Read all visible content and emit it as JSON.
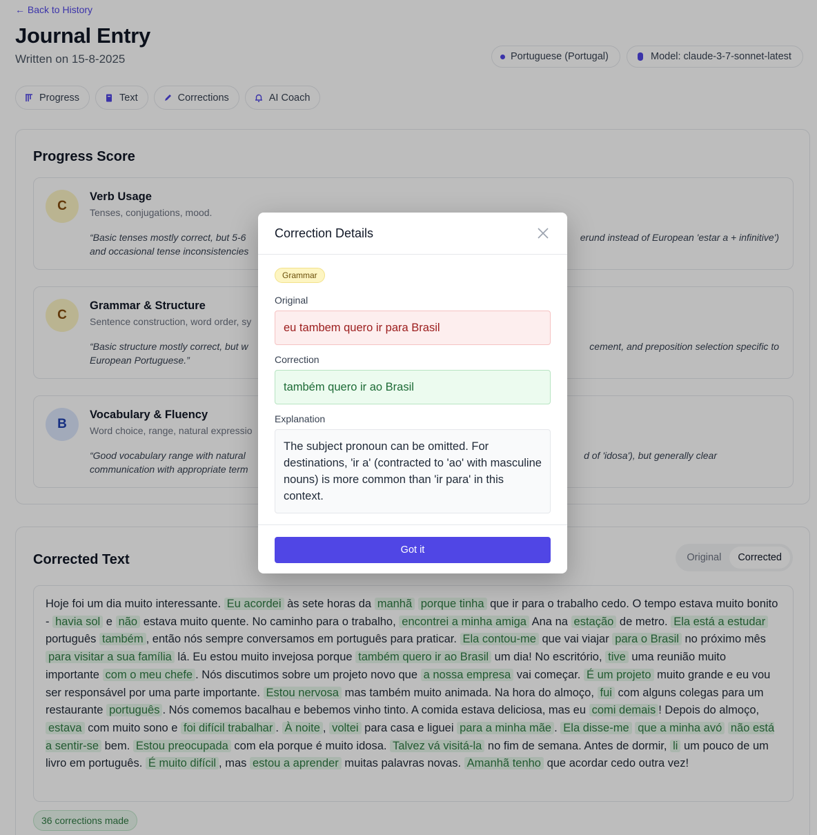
{
  "nav": {
    "back_link": "← Back to History"
  },
  "header": {
    "title": "Journal Entry",
    "written_on": "Written on 15-8-2025",
    "language_pill": "Portuguese (Portugal)",
    "model_pill": "Model: claude-3-7-sonnet-latest"
  },
  "tabs": [
    {
      "label": "Progress",
      "icon": "bars-icon"
    },
    {
      "label": "Text",
      "icon": "book-icon"
    },
    {
      "label": "Corrections",
      "icon": "pencil-icon"
    },
    {
      "label": "AI Coach",
      "icon": "bell-icon"
    }
  ],
  "progress": {
    "title": "Progress Score",
    "items": [
      {
        "grade": "C",
        "name": "Verb Usage",
        "desc": "Tenses, conjugations, mood.",
        "quote_left": "“Basic tenses mostly correct, but 5-6",
        "quote_left2": "and occasional tense inconsistencies",
        "quote_right": "erund instead of European 'estar a + infinitive')"
      },
      {
        "grade": "C",
        "name": "Grammar & Structure",
        "desc": "Sentence construction, word order, sy",
        "quote_left": "“Basic structure mostly correct, but w",
        "quote_left2": "European Portuguese.”",
        "quote_right": "cement, and preposition selection specific to"
      },
      {
        "grade": "B",
        "name": "Vocabulary & Fluency",
        "desc": "Word choice, range, natural expressio",
        "quote_left": "“Good vocabulary range with natural",
        "quote_left2": "communication with appropriate term",
        "quote_right": "d of 'idosa'), but generally clear"
      }
    ]
  },
  "corrected_text": {
    "title": "Corrected Text",
    "toggle_original": "Original",
    "toggle_corrected": "Corrected",
    "segments": [
      {
        "t": "Hoje foi um dia muito interessante. "
      },
      {
        "t": "Eu acordei",
        "h": true
      },
      {
        "t": " às sete horas da "
      },
      {
        "t": "manhã",
        "h": true
      },
      {
        "t": " "
      },
      {
        "t": "porque tinha",
        "h": true
      },
      {
        "t": " que ir para o trabalho cedo. O tempo estava muito bonito - "
      },
      {
        "t": "havia sol",
        "h": true
      },
      {
        "t": " e "
      },
      {
        "t": "não",
        "h": true
      },
      {
        "t": " estava muito quente. No caminho para o trabalho, "
      },
      {
        "t": "encontrei a minha amiga",
        "h": true
      },
      {
        "t": " Ana na "
      },
      {
        "t": "estação",
        "h": true
      },
      {
        "t": " de metro. "
      },
      {
        "t": "Ela está a estudar",
        "h": true
      },
      {
        "t": " português "
      },
      {
        "t": "também",
        "h": true
      },
      {
        "t": ", então nós sempre conversamos em português para praticar. "
      },
      {
        "t": "Ela contou-me",
        "h": true
      },
      {
        "t": " que vai viajar "
      },
      {
        "t": "para o Brasil",
        "h": true
      },
      {
        "t": " no próximo mês "
      },
      {
        "t": "para visitar a sua família",
        "h": true
      },
      {
        "t": " lá. Eu estou muito invejosa porque "
      },
      {
        "t": "também quero ir ao Brasil",
        "h": true
      },
      {
        "t": " um dia! No escritório, "
      },
      {
        "t": "tive",
        "h": true
      },
      {
        "t": " uma reunião muito importante "
      },
      {
        "t": "com o meu chefe",
        "h": true
      },
      {
        "t": ". Nós discutimos sobre um projeto novo que "
      },
      {
        "t": "a nossa empresa",
        "h": true
      },
      {
        "t": " vai começar. "
      },
      {
        "t": "É um projeto",
        "h": true
      },
      {
        "t": " muito grande e eu vou ser responsável por uma parte importante. "
      },
      {
        "t": "Estou nervosa",
        "h": true
      },
      {
        "t": " mas também muito animada. Na hora do almoço, "
      },
      {
        "t": "fui",
        "h": true
      },
      {
        "t": " com alguns colegas para um restaurante "
      },
      {
        "t": "português",
        "h": true
      },
      {
        "t": ". Nós comemos bacalhau e bebemos vinho tinto. A comida estava deliciosa, mas eu "
      },
      {
        "t": "comi demais",
        "h": true
      },
      {
        "t": "! Depois do almoço, "
      },
      {
        "t": "estava",
        "h": true
      },
      {
        "t": " com muito sono e "
      },
      {
        "t": "foi difícil trabalhar",
        "h": true
      },
      {
        "t": ". "
      },
      {
        "t": "À noite",
        "h": true
      },
      {
        "t": ", "
      },
      {
        "t": "voltei",
        "h": true
      },
      {
        "t": " para casa e liguei "
      },
      {
        "t": "para a minha mãe",
        "h": true
      },
      {
        "t": ". "
      },
      {
        "t": "Ela disse-me",
        "h": true
      },
      {
        "t": " "
      },
      {
        "t": "que a minha avó",
        "h": true
      },
      {
        "t": " "
      },
      {
        "t": "não está a sentir-se",
        "h": true
      },
      {
        "t": " bem. "
      },
      {
        "t": "Estou preocupada",
        "h": true
      },
      {
        "t": " com ela porque é muito idosa. "
      },
      {
        "t": "Talvez vá visitá-la",
        "h": true
      },
      {
        "t": " no fim de semana. Antes de dormir, "
      },
      {
        "t": "li",
        "h": true
      },
      {
        "t": " um pouco de um livro em português. "
      },
      {
        "t": "É muito difícil",
        "h": true
      },
      {
        "t": ", mas "
      },
      {
        "t": "estou a aprender",
        "h": true
      },
      {
        "t": " muitas palavras novas. "
      },
      {
        "t": "Amanhã tenho",
        "h": true
      },
      {
        "t": " que acordar cedo outra vez!"
      }
    ],
    "count_badge": "36 corrections made"
  },
  "modal": {
    "title": "Correction Details",
    "category": "Grammar",
    "original_label": "Original",
    "original_text": "eu tambem quero ir para Brasil",
    "correction_label": "Correction",
    "correction_text": "também quero ir ao Brasil",
    "explanation_label": "Explanation",
    "explanation_text": "The subject pronoun can be omitted. For destinations, 'ir a' (contracted to 'ao' with masculine nouns) is more common than 'ir para' in this context.",
    "button_label": "Got it"
  },
  "colors": {
    "accent": "#5046e5",
    "highlight_bg": "#e6f6ea",
    "highlight_text": "#2f7a43"
  }
}
